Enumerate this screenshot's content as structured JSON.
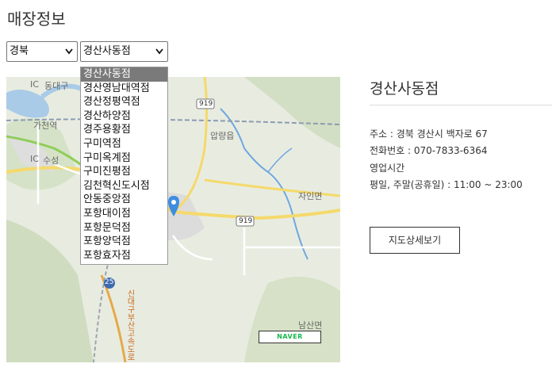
{
  "page": {
    "title": "매장정보"
  },
  "filters": {
    "region": {
      "selected": "경북"
    },
    "store": {
      "selected": "경산사동점",
      "options": [
        "경산사동점",
        "경산영남대역점",
        "경산정평역점",
        "경산하양점",
        "경주용황점",
        "구미역점",
        "구미옥계점",
        "구미진평점",
        "김천혁신도시점",
        "안동중앙점",
        "포항대이점",
        "포항문덕점",
        "포항양덕점",
        "포항효자점"
      ]
    }
  },
  "map": {
    "labels": {
      "dongdaegu": "동대구",
      "gacheon": "가천역",
      "suseong": "수성",
      "apryang": "압량읍",
      "jain": "자인면",
      "namsan": "남산면",
      "r919a": "919",
      "r919b": "919",
      "r25": "25",
      "expressway": "신대구부산고속도로",
      "ic1": "IC",
      "ic2": "IC"
    },
    "brand": "NAVER"
  },
  "store": {
    "name": "경산사동점",
    "address": "주소 : 경북 경산시 백자로 67",
    "phone": "전화번호 : 070-7833-6364",
    "hours_label": "영업시간",
    "hours": "평일, 주말(공휴일) : 11:00 ~ 23:00",
    "detail_button": "지도상세보기"
  },
  "colors": {
    "accent_road": "#f5d96b",
    "marker": "#3d8ee0",
    "brand_green": "#16b94a"
  }
}
